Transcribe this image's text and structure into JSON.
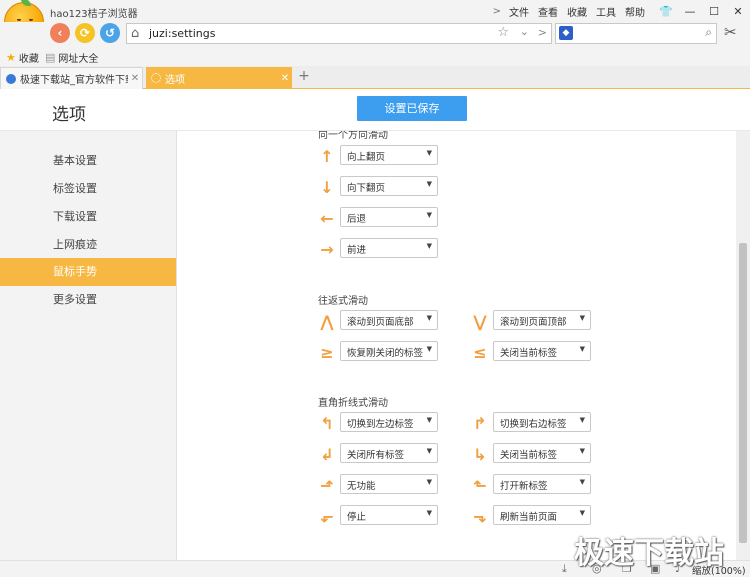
{
  "window": {
    "title": "hao123桔子浏览器",
    "menu": [
      "文件",
      "查看",
      "收藏",
      "工具",
      "帮助"
    ]
  },
  "nav": {
    "url": "juzi:settings"
  },
  "bookmarks": [
    "收藏",
    "网址大全"
  ],
  "tabs": [
    {
      "title": "极速下载站_官方软件下载_(",
      "active": false
    },
    {
      "title": "选项",
      "active": true
    }
  ],
  "header": {
    "title": "选项",
    "saved_button": "设置已保存"
  },
  "sidebar": {
    "items": [
      "基本设置",
      "标签设置",
      "下载设置",
      "上网痕迹",
      "鼠标手势",
      "更多设置"
    ],
    "active_index": 4
  },
  "content": {
    "section1": {
      "title": "向一个方向滑动",
      "items": [
        {
          "icon": "arrow-up-icon",
          "value": "向上翻页"
        },
        {
          "icon": "arrow-down-icon",
          "value": "向下翻页"
        },
        {
          "icon": "arrow-left-icon",
          "value": "后退"
        },
        {
          "icon": "arrow-right-icon",
          "value": "前进"
        }
      ]
    },
    "section2": {
      "title": "往返式滑动",
      "left": [
        {
          "icon": "gesture-up-down-icon",
          "value": "滚动到页面底部"
        },
        {
          "icon": "gesture-right-left-icon",
          "value": "恢复刚关闭的标签"
        }
      ],
      "right": [
        {
          "icon": "gesture-down-up-icon",
          "value": "滚动到页面顶部"
        },
        {
          "icon": "gesture-left-right-icon",
          "value": "关闭当前标签"
        }
      ]
    },
    "section3": {
      "title": "直角折线式滑动",
      "left": [
        {
          "icon": "gesture-up-left-icon",
          "value": "切换到左边标签"
        },
        {
          "icon": "gesture-down-left-icon",
          "value": "关闭所有标签"
        },
        {
          "icon": "gesture-left-up-icon",
          "value": "无功能"
        },
        {
          "icon": "gesture-left-down-icon",
          "value": "停止"
        }
      ],
      "right": [
        {
          "icon": "gesture-up-right-icon",
          "value": "切换到右边标签"
        },
        {
          "icon": "gesture-down-right-icon",
          "value": "关闭当前标签"
        },
        {
          "icon": "gesture-right-up-icon",
          "value": "打开新标签"
        },
        {
          "icon": "gesture-right-down-icon",
          "value": "刷新当前页面"
        }
      ]
    }
  },
  "status": {
    "zoom": "缩放(100%)"
  },
  "watermark": "极速下载站",
  "colors": {
    "accent": "#f6b843",
    "button_blue": "#3d9ef0",
    "gesture_icon": "#f0a040"
  }
}
